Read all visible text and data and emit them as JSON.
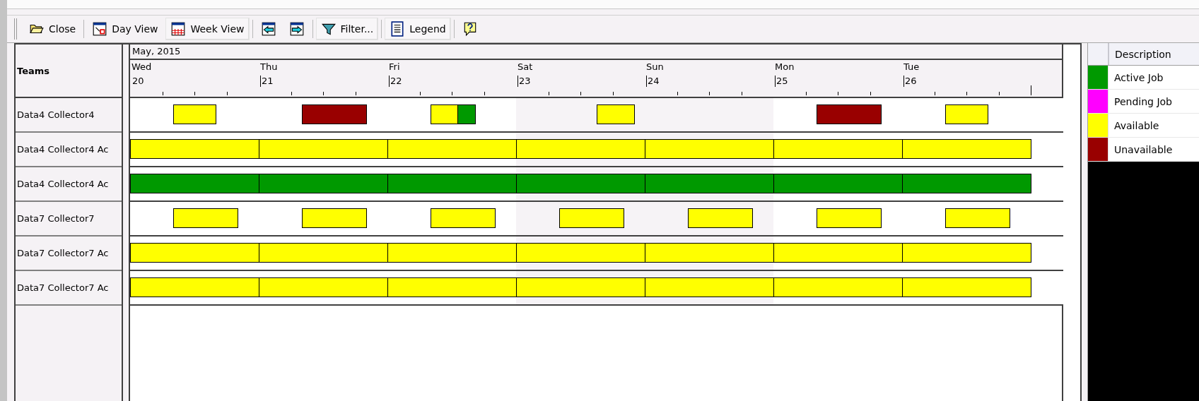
{
  "toolbar": {
    "buttons": [
      {
        "kind": "close",
        "label": "Close",
        "pressed": false
      },
      {
        "kind": "day",
        "label": "Day View",
        "pressed": false
      },
      {
        "kind": "week",
        "label": "Week View",
        "pressed": true
      },
      {
        "kind": "prev",
        "pressed": false
      },
      {
        "kind": "next",
        "pressed": false
      },
      {
        "kind": "filter",
        "label": "Filter...",
        "pressed": true
      },
      {
        "kind": "legend",
        "label": "Legend",
        "pressed": true
      },
      {
        "kind": "help",
        "pressed": false
      }
    ]
  },
  "schedule": {
    "corner_label": "Teams",
    "month": "May, 2015",
    "days": [
      {
        "name": "Wed",
        "date": "20",
        "weekend": false
      },
      {
        "name": "Thu",
        "date": "21",
        "weekend": false
      },
      {
        "name": "Fri",
        "date": "22",
        "weekend": false
      },
      {
        "name": "Sat",
        "date": "23",
        "weekend": true
      },
      {
        "name": "Sun",
        "date": "24",
        "weekend": true
      },
      {
        "name": "Mon",
        "date": "25",
        "weekend": false
      },
      {
        "name": "Tue",
        "date": "26",
        "weekend": false
      }
    ],
    "rows": [
      {
        "team": "Data4 Collector4",
        "bars": [
          {
            "color": "#ffff00"
          },
          {
            "color": "#990000"
          },
          {
            "color": "#ffff00"
          },
          {
            "color": "#009900"
          },
          {
            "color": "#ffff00"
          },
          {
            "color": "#990000"
          },
          {
            "color": "#ffff00"
          }
        ]
      },
      {
        "team": "Data4 Collector4 Ac",
        "bars": [
          {
            "color": "#ffff00"
          },
          {
            "color": "#ffff00"
          },
          {
            "color": "#ffff00"
          },
          {
            "color": "#ffff00"
          },
          {
            "color": "#ffff00"
          },
          {
            "color": "#ffff00"
          },
          {
            "color": "#ffff00"
          }
        ]
      },
      {
        "team": "Data4 Collector4 Ac",
        "bars": [
          {
            "color": "#009900"
          },
          {
            "color": "#009900"
          },
          {
            "color": "#009900"
          },
          {
            "color": "#009900"
          },
          {
            "color": "#009900"
          },
          {
            "color": "#009900"
          },
          {
            "color": "#009900"
          }
        ]
      },
      {
        "team": "Data7 Collector7",
        "bars": [
          {
            "color": "#ffff00"
          },
          {
            "color": "#ffff00"
          },
          {
            "color": "#ffff00"
          },
          {
            "color": "#ffff00"
          },
          {
            "color": "#ffff00"
          },
          {
            "color": "#ffff00"
          },
          {
            "color": "#ffff00"
          }
        ]
      },
      {
        "team": "Data7 Collector7 Ac",
        "bars": [
          {
            "color": "#ffff00"
          },
          {
            "color": "#ffff00"
          },
          {
            "color": "#ffff00"
          },
          {
            "color": "#ffff00"
          },
          {
            "color": "#ffff00"
          },
          {
            "color": "#ffff00"
          },
          {
            "color": "#ffff00"
          }
        ]
      },
      {
        "team": "Data7 Collector7 Ac",
        "bars": [
          {
            "color": "#ffff00"
          },
          {
            "color": "#ffff00"
          },
          {
            "color": "#ffff00"
          },
          {
            "color": "#ffff00"
          },
          {
            "color": "#ffff00"
          },
          {
            "color": "#ffff00"
          },
          {
            "color": "#ffff00"
          }
        ]
      }
    ]
  },
  "legend": {
    "header": "Description",
    "items": [
      {
        "label": "Active Job",
        "color": "#009900"
      },
      {
        "label": "Pending Job",
        "color": "#ff00ff"
      },
      {
        "label": "Available",
        "color": "#ffff00"
      },
      {
        "label": "Unavailable",
        "color": "#990000"
      }
    ]
  }
}
